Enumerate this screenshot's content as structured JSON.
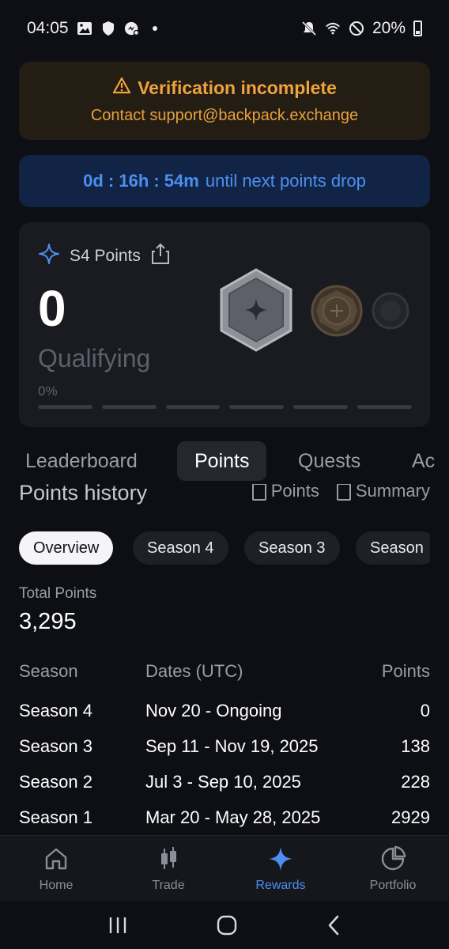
{
  "status_bar": {
    "time": "04:05",
    "battery": "20%",
    "icons": [
      "image-icon",
      "shield-icon",
      "messenger-icon",
      "mute-icon",
      "wifi-icon",
      "do-not-disturb-icon",
      "battery-icon"
    ]
  },
  "warning_banner": {
    "title": "Verification incomplete",
    "subtitle": "Contact support@backpack.exchange",
    "color": "#f0a33a"
  },
  "timer_banner": {
    "countdown": "0d : 16h : 54m",
    "text": "until next points drop",
    "color": "#4c8ff2"
  },
  "points_card": {
    "title": "S4 Points",
    "value": "0",
    "tier": "Qualifying",
    "progress_label": "0%",
    "progress": 0,
    "segments": 6
  },
  "tabs": [
    {
      "label": "Leaderboard",
      "active": false
    },
    {
      "label": "Points",
      "active": true
    },
    {
      "label": "Quests",
      "active": false
    },
    {
      "label": "Ac",
      "active": false
    }
  ],
  "history": {
    "title": "Points history",
    "link_points": "Points",
    "link_summary": "Summary"
  },
  "chips": [
    {
      "label": "Overview",
      "active": true
    },
    {
      "label": "Season 4",
      "active": false
    },
    {
      "label": "Season 3",
      "active": false
    },
    {
      "label": "Season",
      "active": false
    }
  ],
  "total": {
    "label": "Total Points",
    "value": "3,295"
  },
  "table": {
    "headers": {
      "season": "Season",
      "dates": "Dates (UTC)",
      "points": "Points"
    },
    "rows": [
      {
        "season": "Season 4",
        "dates": "Nov 20 - Ongoing",
        "points": "0"
      },
      {
        "season": "Season 3",
        "dates": "Sep 11 - Nov 19, 2025",
        "points": "138"
      },
      {
        "season": "Season 2",
        "dates": "Jul 3 - Sep 10, 2025",
        "points": "228"
      },
      {
        "season": "Season 1",
        "dates": "Mar 20 - May 28, 2025",
        "points": "2929"
      }
    ]
  },
  "bottom_nav": [
    {
      "label": "Home",
      "icon": "home-icon",
      "active": false
    },
    {
      "label": "Trade",
      "icon": "candlestick-icon",
      "active": false
    },
    {
      "label": "Rewards",
      "icon": "sparkle-icon",
      "active": true
    },
    {
      "label": "Portfolio",
      "icon": "pie-chart-icon",
      "active": false
    }
  ]
}
